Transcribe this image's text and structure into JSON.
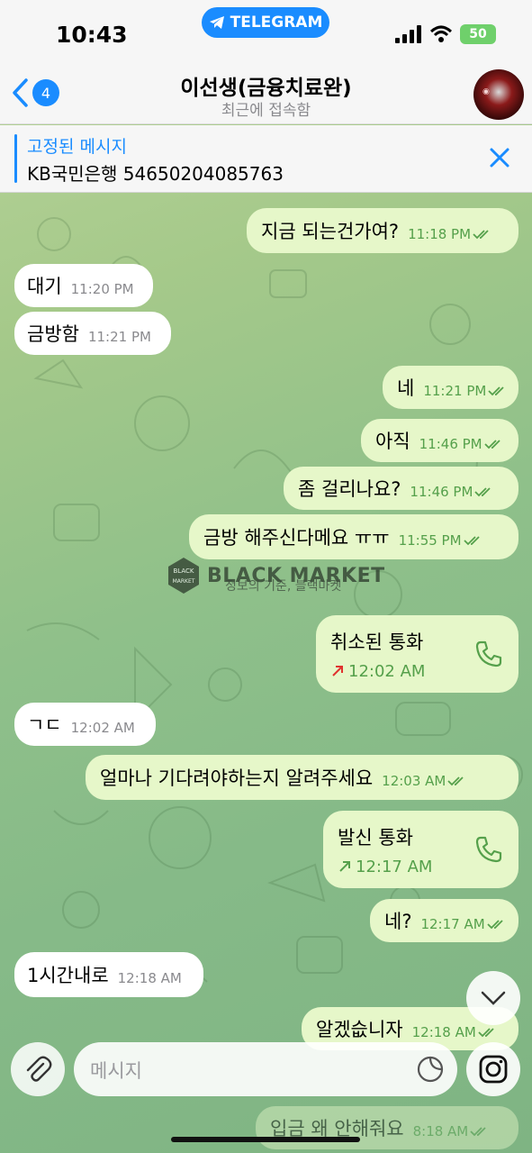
{
  "status_bar": {
    "time": "10:43",
    "pill_label": "TELEGRAM",
    "battery": "50"
  },
  "header": {
    "back_count": "4",
    "title": "이선생(금융치료완)",
    "subtitle": "최근에 접속함"
  },
  "pinned": {
    "title": "고정된 메시지",
    "text": "KB국민은행 54650204085763"
  },
  "messages": [
    {
      "dir": "out",
      "text": "지금 되는건가여?",
      "time": "11:18 PM"
    },
    {
      "dir": "in",
      "text": "대기",
      "time": "11:20 PM"
    },
    {
      "dir": "in",
      "text": "금방함",
      "time": "11:21 PM"
    },
    {
      "dir": "out",
      "text": "네",
      "time": "11:21 PM"
    },
    {
      "dir": "out",
      "text": "아직",
      "time": "11:46 PM"
    },
    {
      "dir": "out",
      "text": "좀 걸리나요?",
      "time": "11:46 PM"
    },
    {
      "dir": "out",
      "text": "금방 해주신다메요 ㅠㅠ",
      "time": "11:55 PM"
    },
    {
      "dir": "in",
      "text": "ㄱㄷ",
      "time": "12:02 AM"
    },
    {
      "dir": "out",
      "text": "얼마나 기다려야하는지 알려주세요",
      "time": "12:03 AM"
    },
    {
      "dir": "out",
      "text": "네?",
      "time": "12:17 AM"
    },
    {
      "dir": "in",
      "text": "1시간내로",
      "time": "12:18 AM"
    },
    {
      "dir": "out",
      "text": "알겠슶니자",
      "time": "12:18 AM"
    },
    {
      "dir": "out",
      "text": "입금 왜 안해줘요",
      "time": "8:18 AM"
    }
  ],
  "calls": [
    {
      "title": "취소된 통화",
      "time": "12:02 AM",
      "status": "cancelled"
    },
    {
      "title": "발신 통화",
      "time": "12:17 AM",
      "status": "outgoing"
    }
  ],
  "watermark": {
    "brand": "BLACK MARKET",
    "tagline": "정보의 기준, 블랙마켓",
    "badge_top": "BLACK",
    "badge_bottom": "MARKET"
  },
  "input": {
    "placeholder": "메시지"
  },
  "colors": {
    "accent": "#1a8cff",
    "outgoing_bubble": "#e6f7c9",
    "incoming_bubble": "#ffffff",
    "read_check": "#55a04b"
  }
}
